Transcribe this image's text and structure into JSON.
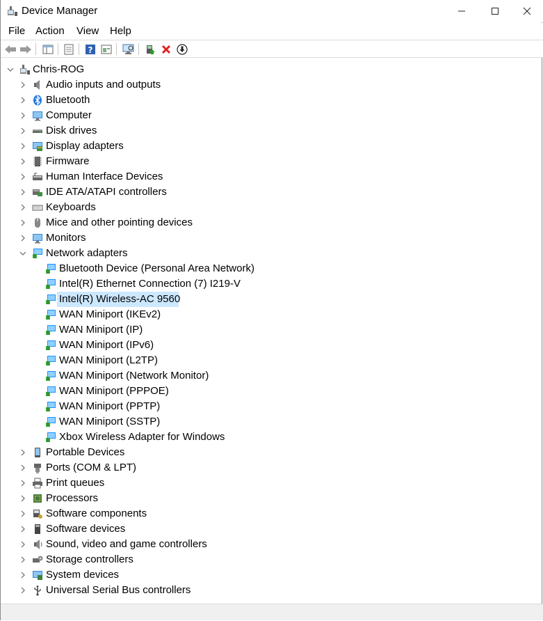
{
  "window": {
    "title": "Device Manager",
    "minimize": "—",
    "maximize": "☐",
    "close": "✕"
  },
  "menu": [
    "File",
    "Action",
    "View",
    "Help"
  ],
  "toolbar": {
    "buttons": [
      "back",
      "forward",
      "show-hide-console-tree",
      "properties",
      "help",
      "refresh-view",
      "scan-for-hardware-changes",
      "update-driver",
      "uninstall-device",
      "disable-device"
    ]
  },
  "tree": {
    "root": "Chris-ROG",
    "categories": [
      {
        "label": "Audio inputs and outputs",
        "icon": "speaker-icon"
      },
      {
        "label": "Bluetooth",
        "icon": "bluetooth-icon"
      },
      {
        "label": "Computer",
        "icon": "computer-icon"
      },
      {
        "label": "Disk drives",
        "icon": "disk-drive-icon"
      },
      {
        "label": "Display adapters",
        "icon": "display-adapter-icon"
      },
      {
        "label": "Firmware",
        "icon": "firmware-icon"
      },
      {
        "label": "Human Interface Devices",
        "icon": "hid-icon"
      },
      {
        "label": "IDE ATA/ATAPI controllers",
        "icon": "ide-controller-icon"
      },
      {
        "label": "Keyboards",
        "icon": "keyboard-icon"
      },
      {
        "label": "Mice and other pointing devices",
        "icon": "mouse-icon"
      },
      {
        "label": "Monitors",
        "icon": "monitor-icon"
      },
      {
        "label": "Network adapters",
        "icon": "network-adapter-icon",
        "expanded": true,
        "children": [
          "Bluetooth Device (Personal Area Network)",
          "Intel(R) Ethernet Connection (7) I219-V",
          "Intel(R) Wireless-AC 9560",
          "WAN Miniport (IKEv2)",
          "WAN Miniport (IP)",
          "WAN Miniport (IPv6)",
          "WAN Miniport (L2TP)",
          "WAN Miniport (Network Monitor)",
          "WAN Miniport (PPPOE)",
          "WAN Miniport (PPTP)",
          "WAN Miniport (SSTP)",
          "Xbox Wireless Adapter for Windows"
        ],
        "selected_child": "Intel(R) Wireless-AC 9560"
      },
      {
        "label": "Portable Devices",
        "icon": "portable-device-icon"
      },
      {
        "label": "Ports (COM & LPT)",
        "icon": "port-icon"
      },
      {
        "label": "Print queues",
        "icon": "printer-icon"
      },
      {
        "label": "Processors",
        "icon": "processor-icon"
      },
      {
        "label": "Software components",
        "icon": "software-component-icon"
      },
      {
        "label": "Software devices",
        "icon": "software-device-icon"
      },
      {
        "label": "Sound, video and game controllers",
        "icon": "sound-controller-icon"
      },
      {
        "label": "Storage controllers",
        "icon": "storage-controller-icon"
      },
      {
        "label": "System devices",
        "icon": "system-device-icon"
      },
      {
        "label": "Universal Serial Bus controllers",
        "icon": "usb-icon"
      }
    ]
  },
  "colors": {
    "selection": "#cce8ff",
    "net_icon": "#1e90ff"
  }
}
